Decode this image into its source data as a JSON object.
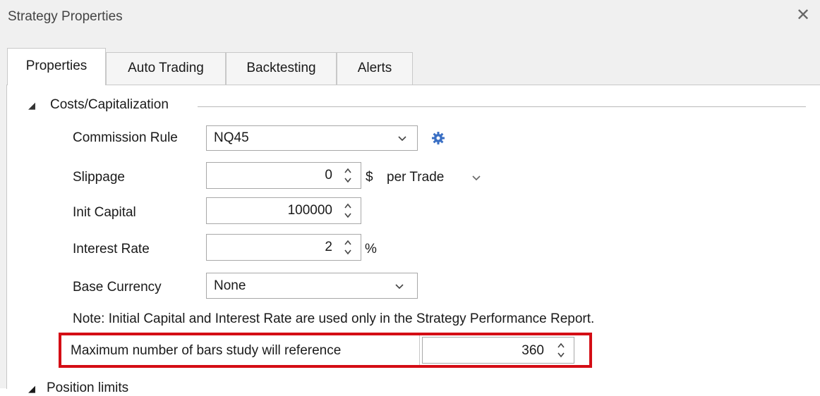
{
  "window": {
    "title": "Strategy Properties",
    "close_symbol": "✕"
  },
  "tabs": [
    {
      "label": "Properties",
      "active": true
    },
    {
      "label": "Auto Trading",
      "active": false
    },
    {
      "label": "Backtesting",
      "active": false
    },
    {
      "label": "Alerts",
      "active": false
    }
  ],
  "costs": {
    "section_title": "Costs/Capitalization",
    "commission_rule": {
      "label": "Commission Rule",
      "value": "NQ45"
    },
    "slippage": {
      "label": "Slippage",
      "value": "0",
      "unit": "$",
      "mode": "per Trade"
    },
    "init_capital": {
      "label": "Init Capital",
      "value": "100000"
    },
    "interest_rate": {
      "label": "Interest Rate",
      "value": "2",
      "unit": "%"
    },
    "base_currency": {
      "label": "Base Currency",
      "value": "None"
    },
    "note": "Note: Initial Capital and Interest Rate are used only in the Strategy Performance Report.",
    "max_bars": {
      "label": "Maximum number of bars study will reference",
      "value": "360"
    }
  },
  "next_section_title": "Position limits",
  "colors": {
    "highlight": "#d40d15",
    "gear": "#3a6fc4",
    "chrome": "#f0f0f0"
  },
  "icons": [
    "collapse-triangle-icon",
    "chevron-down-icon",
    "spinner-arrows-icon",
    "gear-icon",
    "close-icon"
  ]
}
